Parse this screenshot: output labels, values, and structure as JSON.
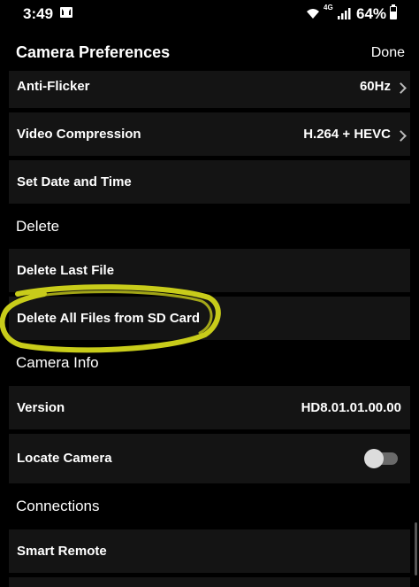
{
  "status_bar": {
    "time": "3:49",
    "network": "4G",
    "battery": "64%",
    "icons": [
      "mail-icon",
      "wifi-icon",
      "signal-icon",
      "battery-icon"
    ]
  },
  "header": {
    "title": "Camera Preferences",
    "done_label": "Done"
  },
  "rows": {
    "anti_flicker": {
      "label": "Anti-Flicker",
      "value": "60Hz"
    },
    "video_compression": {
      "label": "Video Compression",
      "value": "H.264 + HEVC"
    },
    "set_date_time": {
      "label": "Set Date and Time"
    },
    "delete_last": {
      "label": "Delete Last File"
    },
    "delete_all": {
      "label": "Delete All Files from SD Card"
    },
    "version": {
      "label": "Version",
      "value": "HD8.01.01.00.00"
    },
    "locate_camera": {
      "label": "Locate Camera",
      "toggle_on": false
    },
    "smart_remote": {
      "label": "Smart Remote"
    }
  },
  "sections": {
    "delete": "Delete",
    "camera_info": "Camera Info",
    "connections": "Connections"
  },
  "colors": {
    "background": "#000000",
    "row_background": "#141414",
    "highlight_stroke": "#c8cc1a"
  }
}
